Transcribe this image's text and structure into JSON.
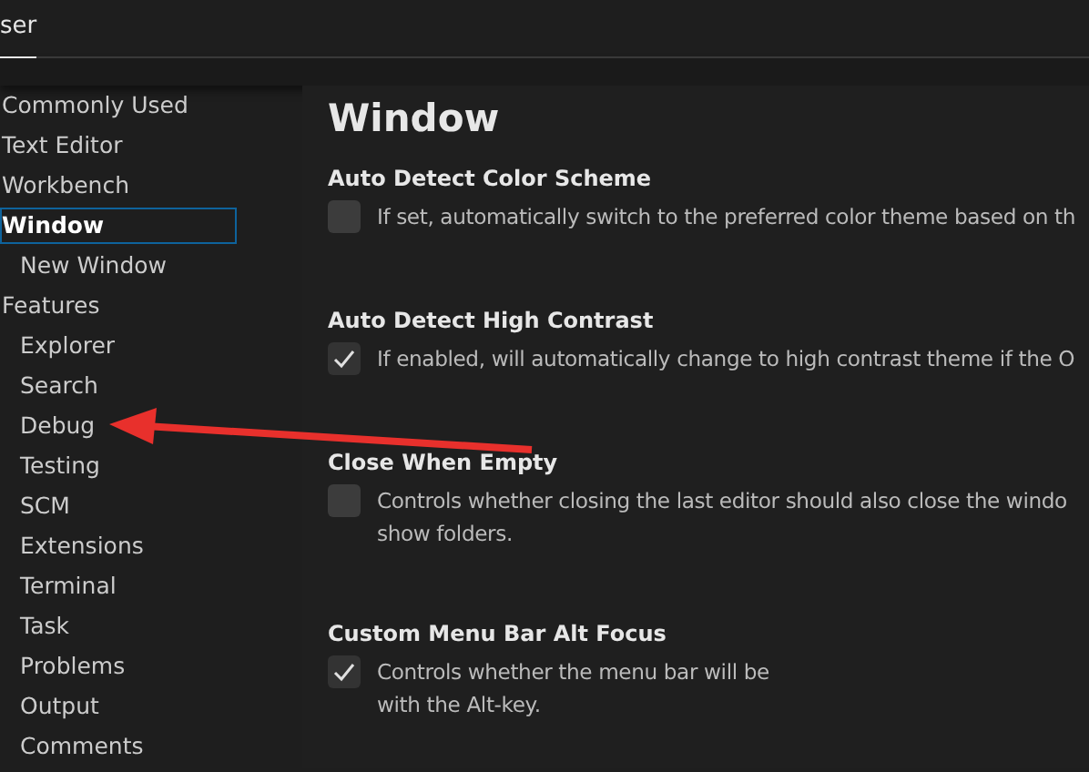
{
  "tabs": [
    {
      "label": "ser",
      "selected": true
    }
  ],
  "toc": [
    {
      "label": "Commonly Used",
      "selected": false
    },
    {
      "label": "Text Editor",
      "selected": false
    },
    {
      "label": "Workbench",
      "selected": false
    },
    {
      "label": "Window",
      "selected": true,
      "children": [
        {
          "label": "New Window",
          "selected": false
        }
      ]
    },
    {
      "label": "Features",
      "selected": false,
      "children": [
        {
          "label": "Explorer",
          "selected": false
        },
        {
          "label": "Search",
          "selected": false
        },
        {
          "label": "Debug",
          "selected": false
        },
        {
          "label": "Testing",
          "selected": false
        },
        {
          "label": "SCM",
          "selected": false
        },
        {
          "label": "Extensions",
          "selected": false
        },
        {
          "label": "Terminal",
          "selected": false
        },
        {
          "label": "Task",
          "selected": false
        },
        {
          "label": "Problems",
          "selected": false
        },
        {
          "label": "Output",
          "selected": false
        },
        {
          "label": "Comments",
          "selected": false
        }
      ]
    }
  ],
  "section_title": "Window",
  "settings": [
    {
      "title": "Auto Detect Color Scheme",
      "checked": false,
      "description": [
        "If set, automatically switch to the preferred color theme based on th"
      ]
    },
    {
      "title": "Auto Detect High Contrast",
      "checked": true,
      "description": [
        "If enabled, will automatically change to high contrast theme if the O"
      ]
    },
    {
      "title": "Close When Empty",
      "checked": false,
      "description": [
        "Controls whether closing the last editor should also close the windo",
        "show folders."
      ]
    },
    {
      "title": "Custom Menu Bar Alt Focus",
      "checked": true,
      "description": [
        "Controls whether the menu bar will be",
        "with the Alt-key."
      ]
    }
  ]
}
